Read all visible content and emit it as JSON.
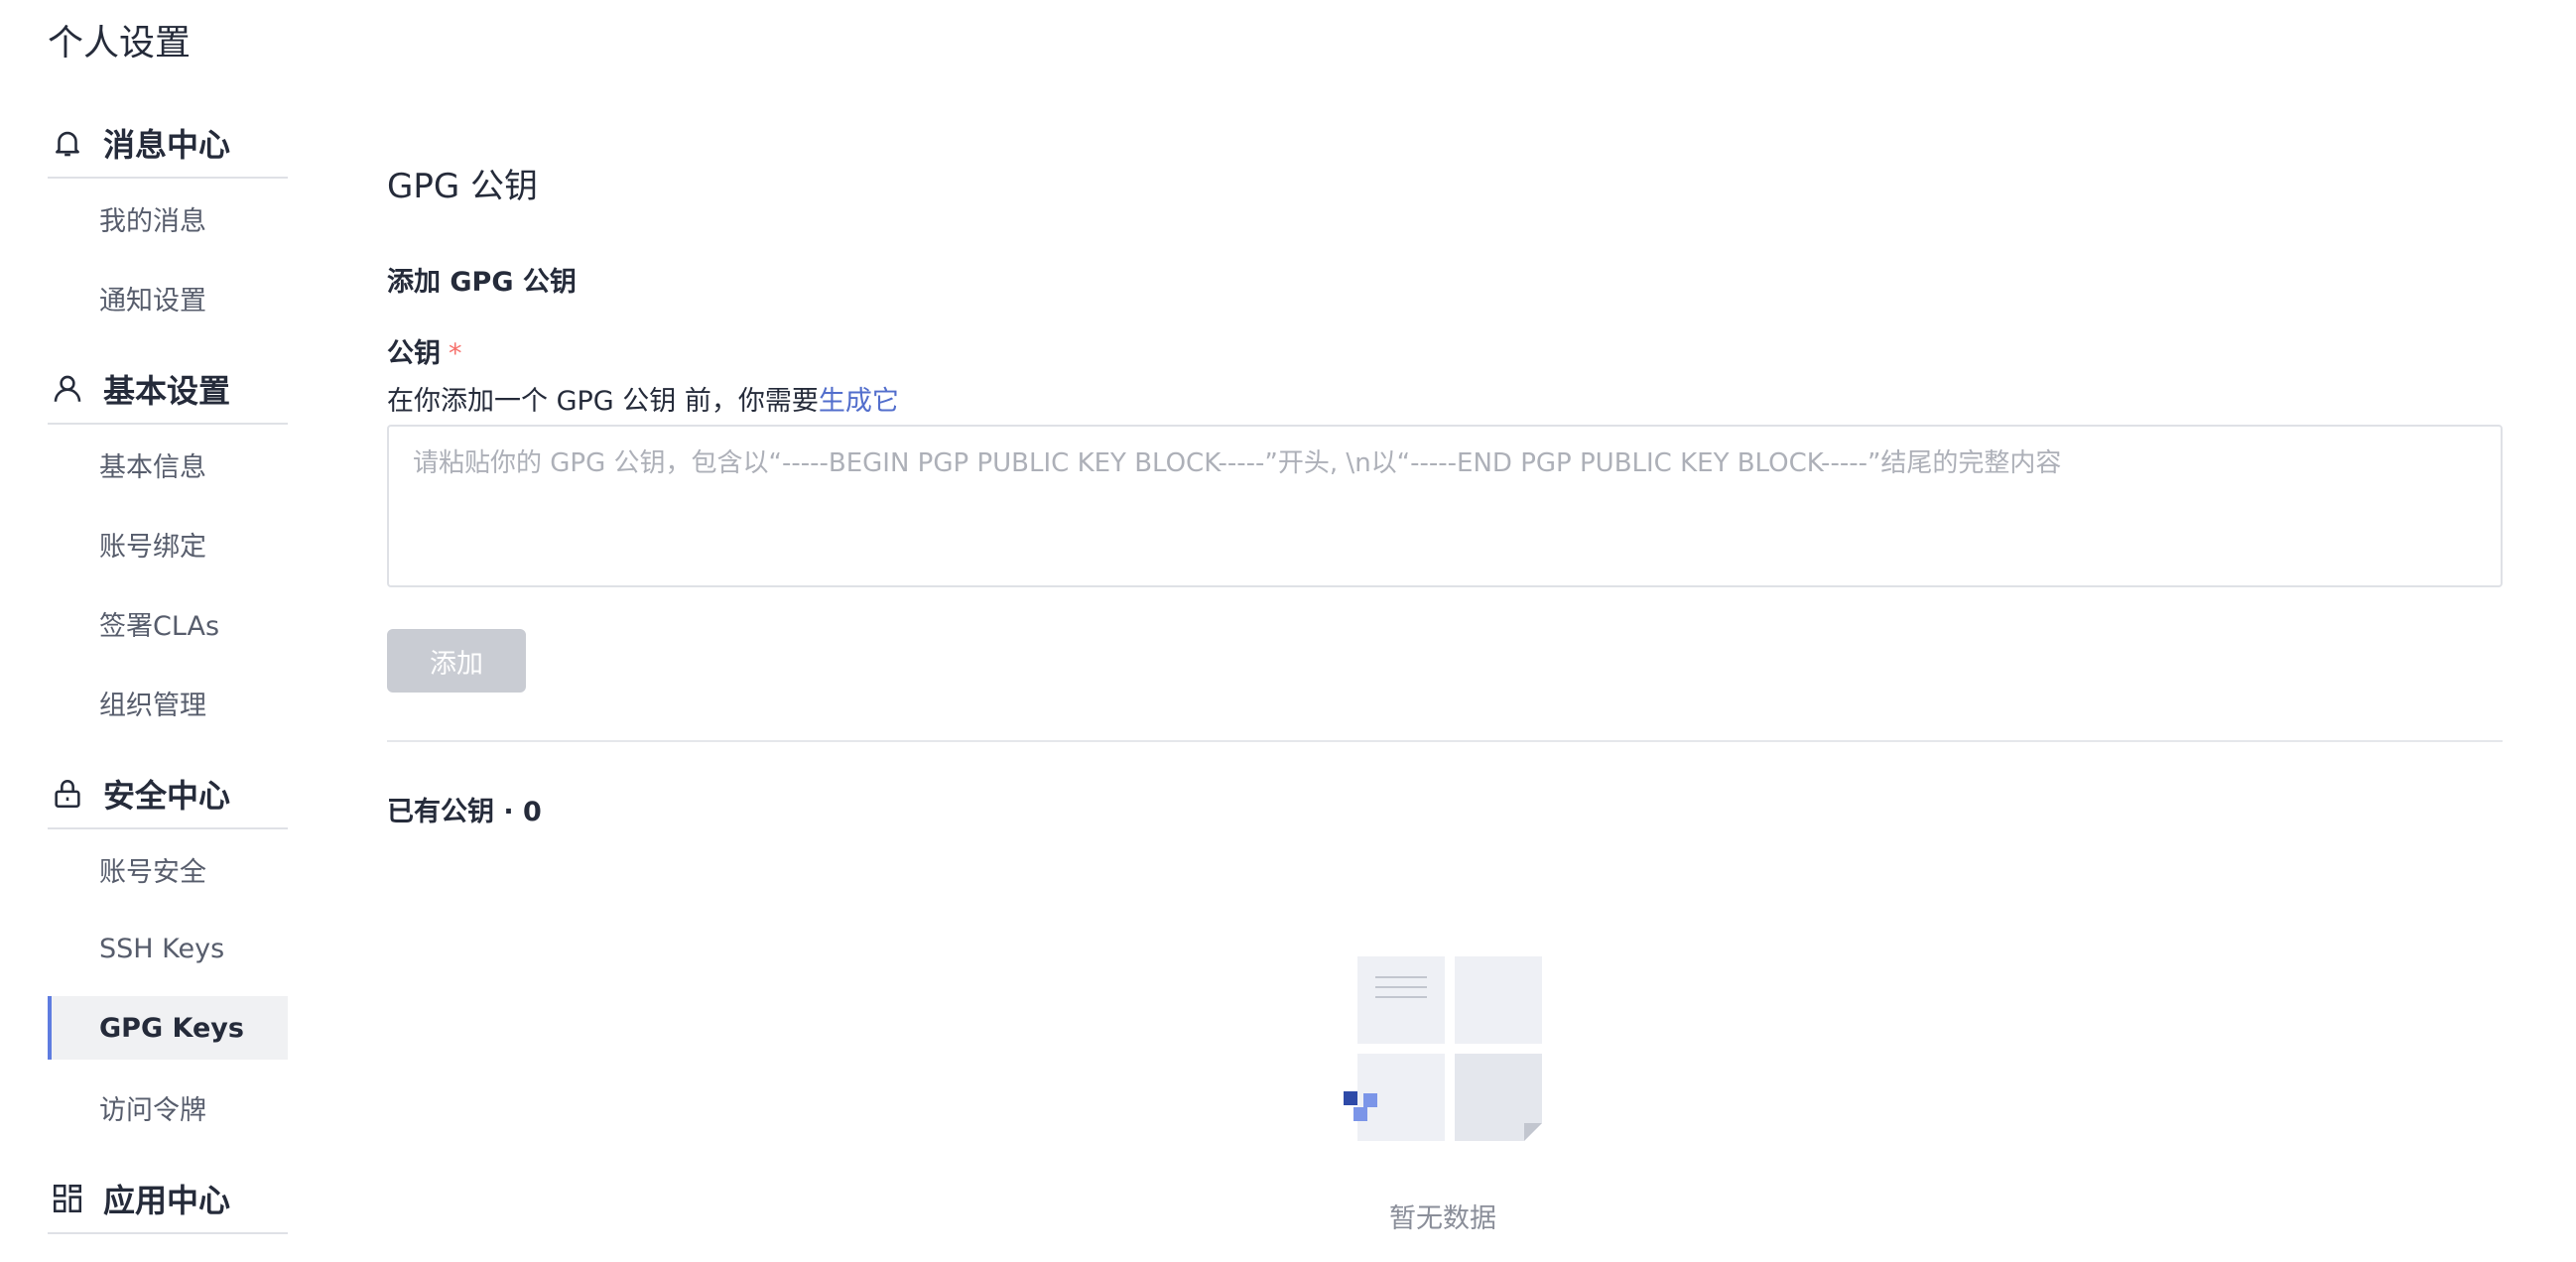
{
  "page": {
    "title": "个人设置"
  },
  "sidebar": {
    "groups": [
      {
        "title": "消息中心",
        "icon": "bell-icon",
        "items": [
          "我的消息",
          "通知设置"
        ]
      },
      {
        "title": "基本设置",
        "icon": "user-icon",
        "items": [
          "基本信息",
          "账号绑定",
          "签署CLAs",
          "组织管理"
        ]
      },
      {
        "title": "安全中心",
        "icon": "lock-icon",
        "items": [
          "账号安全",
          "SSH Keys",
          "GPG Keys",
          "访问令牌"
        ]
      },
      {
        "title": "应用中心",
        "icon": "apps-icon",
        "items": []
      }
    ],
    "active_item": "GPG Keys"
  },
  "main": {
    "section_title": "GPG 公钥",
    "add_title": "添加 GPG 公钥",
    "field_label": "公钥",
    "required_mark": "*",
    "hint_prefix": "在你添加一个 GPG 公钥 前，你需要",
    "hint_link": "生成它",
    "placeholder": "请粘贴你的 GPG 公钥，包含以“-----BEGIN PGP PUBLIC KEY BLOCK-----”开头, \\n以“-----END PGP PUBLIC KEY BLOCK-----”结尾的完整内容",
    "add_button": "添加",
    "existing_label": "已有公钥 · 0",
    "empty_text": "暂无数据"
  },
  "colors": {
    "accent": "#5e7ce0",
    "link": "#526ecc",
    "required": "#f66f6a",
    "disabled_button": "#c9ccd3"
  }
}
